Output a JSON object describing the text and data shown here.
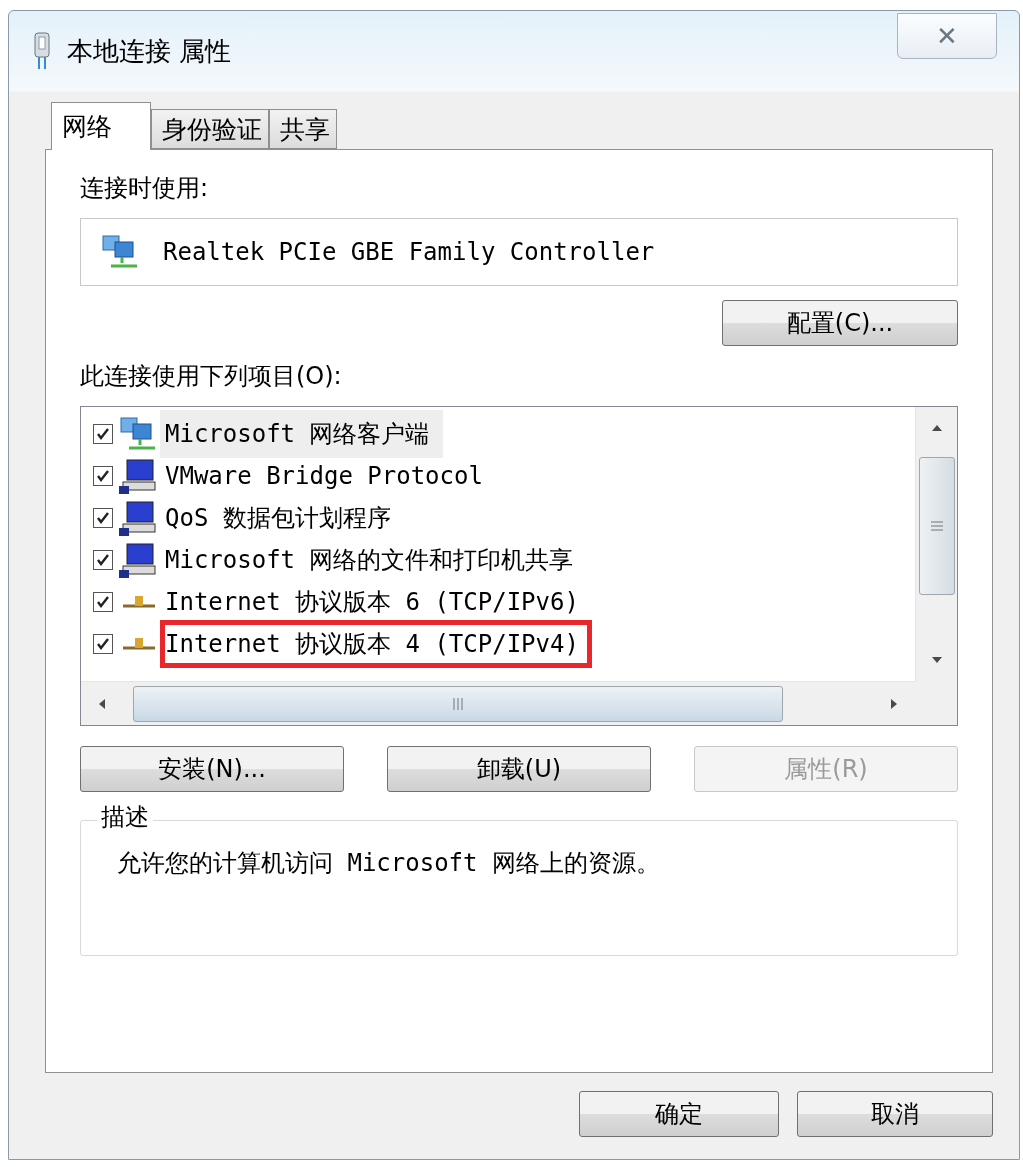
{
  "window": {
    "title": "本地连接 属性",
    "close": "✕"
  },
  "tabs": [
    {
      "label": "网络",
      "selected": true
    },
    {
      "label": "身份验证",
      "selected": false
    },
    {
      "label": "共享",
      "selected": false
    }
  ],
  "connect_using": {
    "label": "连接时使用:",
    "adapter": "Realtek PCIe GBE Family Controller",
    "configure_button": "配置(C)..."
  },
  "items_label": "此连接使用下列项目(O):",
  "items": [
    {
      "kind": "client",
      "label": "Microsoft 网络客户端",
      "checked": true,
      "selected": true,
      "annotated": false
    },
    {
      "kind": "service",
      "label": "VMware Bridge Protocol",
      "checked": true,
      "selected": false,
      "annotated": false
    },
    {
      "kind": "service",
      "label": "QoS 数据包计划程序",
      "checked": true,
      "selected": false,
      "annotated": false
    },
    {
      "kind": "service",
      "label": "Microsoft 网络的文件和打印机共享",
      "checked": true,
      "selected": false,
      "annotated": false
    },
    {
      "kind": "protocol",
      "label": "Internet 协议版本 6 (TCP/IPv6)",
      "checked": true,
      "selected": false,
      "annotated": false
    },
    {
      "kind": "protocol",
      "label": "Internet 协议版本 4 (TCP/IPv4)",
      "checked": true,
      "selected": false,
      "annotated": true
    }
  ],
  "item_buttons": [
    {
      "label": "安装(N)...",
      "disabled": false
    },
    {
      "label": "卸载(U)",
      "disabled": false
    },
    {
      "label": "属性(R)",
      "disabled": true
    }
  ],
  "description": {
    "legend": "描述",
    "text": "允许您的计算机访问 Microsoft 网络上的资源。"
  },
  "dialog_buttons": [
    "确定",
    "取消"
  ]
}
